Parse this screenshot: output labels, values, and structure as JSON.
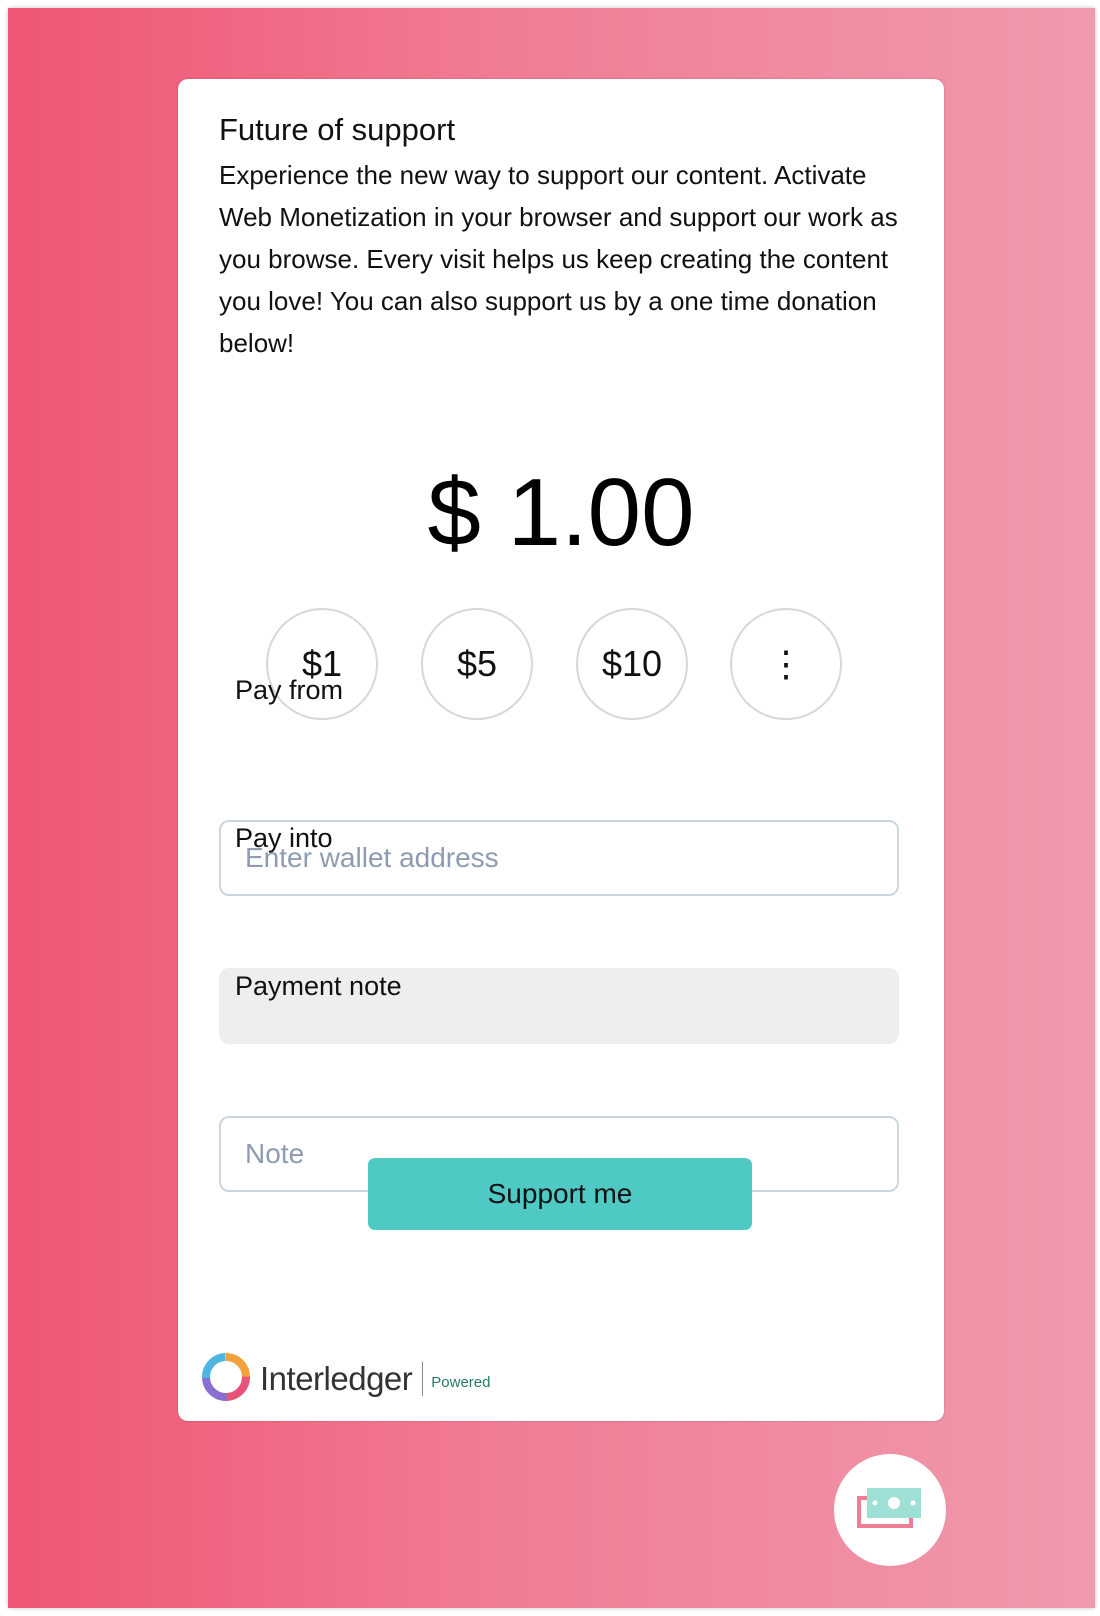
{
  "card": {
    "title": "Future of support",
    "description": "Experience the new way to support our content. Activate Web Monetization in your browser and support our work as you browse. Every visit helps us keep creating the content you love! You can also support us by a one time donation below!",
    "amount": "$ 1.00",
    "presets": [
      {
        "label": "$1"
      },
      {
        "label": "$5"
      },
      {
        "label": "$10"
      },
      {
        "label": "⋮"
      }
    ],
    "pay_from": {
      "label": "Pay from",
      "placeholder": "Enter wallet address",
      "value": ""
    },
    "pay_into": {
      "label": "Pay into",
      "value": ""
    },
    "note": {
      "label": "Payment note",
      "placeholder": "Note",
      "value": ""
    },
    "submit_label": "Support me"
  },
  "brand": {
    "name": "Interledger",
    "powered": "Powered",
    "logo_icon": "interledger-ring-logo"
  },
  "fab": {
    "icon": "money-bill-icon"
  },
  "colors": {
    "gradient_start": "#ef5574",
    "gradient_end": "#f09aad",
    "button": "#4fc9c4",
    "input_border": "#cdd5de",
    "placeholder": "#8e9bb0"
  }
}
